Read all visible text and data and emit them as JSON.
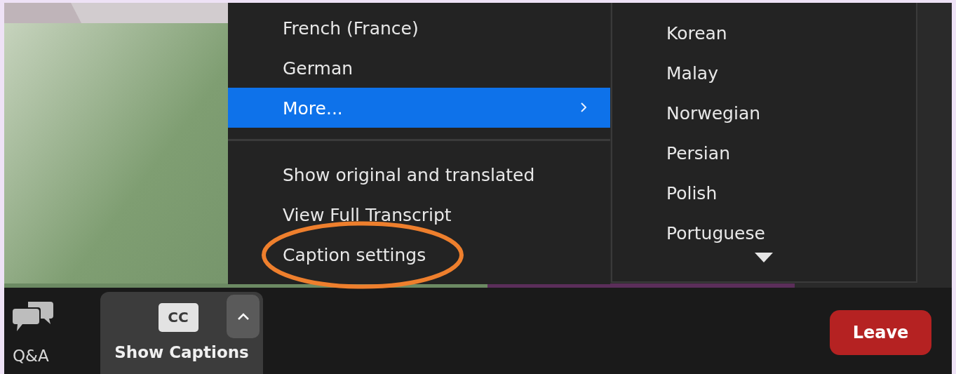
{
  "captions_menu": {
    "language_items": [
      {
        "label": "French (France)",
        "kind": "option",
        "selected": false
      },
      {
        "label": "German",
        "kind": "option",
        "selected": false
      },
      {
        "label": "More...",
        "kind": "submenu",
        "selected": true
      }
    ],
    "option_items": [
      {
        "label": "Show original and translated",
        "circled": false
      },
      {
        "label": "View Full Transcript",
        "circled": false
      },
      {
        "label": "Caption settings",
        "circled": true
      }
    ]
  },
  "language_submenu": {
    "items": [
      "Korean",
      "Malay",
      "Norwegian",
      "Persian",
      "Polish",
      "Portuguese"
    ]
  },
  "toolbar": {
    "qa_label": "Q&A",
    "captions_badge": "CC",
    "captions_label": "Show Captions",
    "leave_label": "Leave"
  }
}
